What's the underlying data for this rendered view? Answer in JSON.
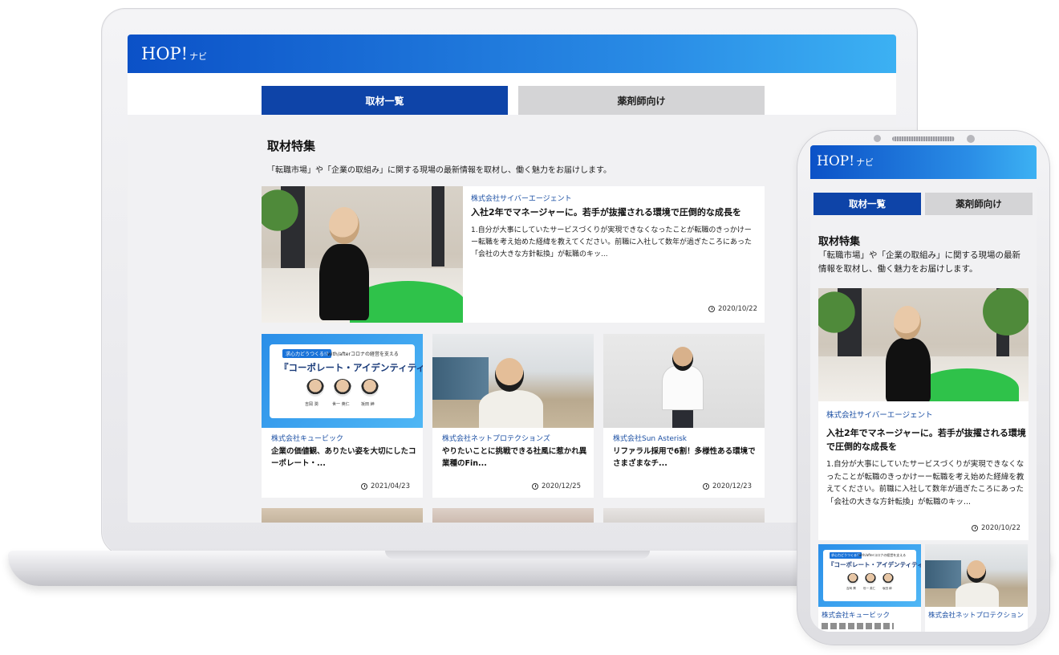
{
  "site": {
    "logo_text": "HOP!",
    "logo_sub": "ナビ"
  },
  "tabs": [
    {
      "label": "取材一覧",
      "active": true
    },
    {
      "label": "薬剤師向け",
      "active": false
    }
  ],
  "section": {
    "title": "取材特集",
    "description": "「転職市場」や「企業の取組み」に関する現場の最新情報を取材し、働く魅力をお届けします。"
  },
  "featured": {
    "company": "株式会社サイバーエージェント",
    "headline": "入社2年でマネージャーに。若手が抜擢される環境で圧倒的な成長を",
    "excerpt": "1.自分が大事にしていたサービスづくりが実現できなくなったことが転職のきっかけーー転職を考え始めた経緯を教えてください。前職に入社して数年が過ぎたころにあった「会社の大きな方針転換」が転職のキッ...",
    "date": "2020/10/22"
  },
  "cards": [
    {
      "company": "株式会社キュービック",
      "headline": "企業の価値観、ありたい姿を大切にしたコーポレート・...",
      "date": "2021/04/23",
      "banner": {
        "tag": "求心力どうつくる!?",
        "sub": "with/afterコロナの経営を支える",
        "title": "『コーポレート・アイデンティティ』",
        "names": [
          "吉岡 潤",
          "世一 英仁",
          "坂田 紳"
        ]
      }
    },
    {
      "company": "株式会社ネットプロテクションズ",
      "headline": "やりたいことに挑戦できる社風に惹かれ異業種のFin...",
      "date": "2020/12/25"
    },
    {
      "company": "株式会社Sun Asterisk",
      "headline": "リファラル採用で6割！多様性ある環境でさまざまなチ...",
      "date": "2020/12/23"
    }
  ],
  "phone_cards": [
    {
      "company": "株式会社キュービック"
    },
    {
      "company": "株式会社ネットプロテクション"
    }
  ],
  "colors": {
    "header_start": "#0b51c7",
    "header_end": "#3cb1f3",
    "tab_active": "#0e44a8",
    "tab_inactive": "#d4d4d6",
    "company_text": "#1b4fa3"
  }
}
